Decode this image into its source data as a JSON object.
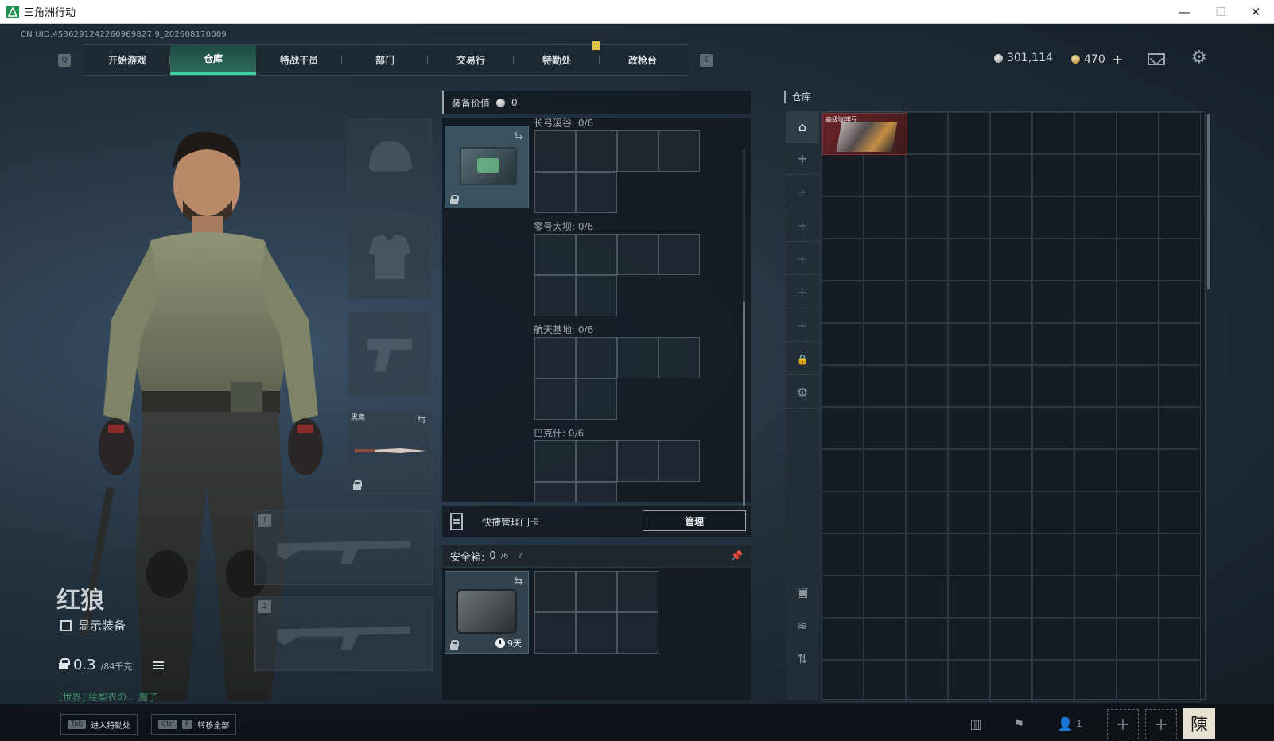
{
  "window": {
    "title": "三角洲行动",
    "controls": {
      "minimize": "—",
      "maximize": "☐",
      "close": "✕"
    }
  },
  "uid": "CN UID:4536291242260969827 9_202608170009",
  "nav": {
    "left_key": "Q",
    "right_key": "E",
    "tabs": [
      {
        "label": "开始游戏",
        "active": false
      },
      {
        "label": "仓库",
        "active": true
      },
      {
        "label": "特战干员",
        "active": false
      },
      {
        "label": "部门",
        "active": false
      },
      {
        "label": "交易行",
        "active": false
      },
      {
        "label": "特勤处",
        "active": false
      },
      {
        "label": "改枪台",
        "active": false
      }
    ],
    "notice_badge": "!"
  },
  "currency": {
    "silver": "301,114",
    "gold": "470",
    "plus": "+"
  },
  "character": {
    "name": "红狼",
    "show_equipment_label": "显示装备",
    "weight_value": "0.3",
    "weight_max": "/84千克",
    "chat": "[世界] 绘梨衣の... 魔了"
  },
  "equipment": {
    "melee_label": "黑鹰",
    "weapon_slot_1": "1",
    "weapon_slot_2": "2"
  },
  "mid": {
    "value_label": "装备价值",
    "value": "0",
    "maps": [
      {
        "label": "长弓溪谷: 0/6"
      },
      {
        "label": "零号大坝: 0/6"
      },
      {
        "label": "航天基地: 0/6"
      },
      {
        "label": "巴克什: 0/6"
      }
    ],
    "keycard_label": "快捷管理门卡",
    "manage_button": "管理",
    "safe_label": "安全箱:",
    "safe_count": "0",
    "safe_max": "/6",
    "safe_help": "?",
    "safe_timer": "9天"
  },
  "warehouse": {
    "title": "仓库",
    "item_name": "高级咖啡豆"
  },
  "bottom": {
    "hint1_key": "Tab",
    "hint1_label": "进入特勤处",
    "hint2_key1": "Ctrl",
    "hint2_key2": "F",
    "hint2_label": "转移全部",
    "friends_count": "1",
    "avatar_char": "陳"
  },
  "colors": {
    "accent": "#3fd39b",
    "item_red": "#6b2428",
    "background": "#1b2530"
  }
}
